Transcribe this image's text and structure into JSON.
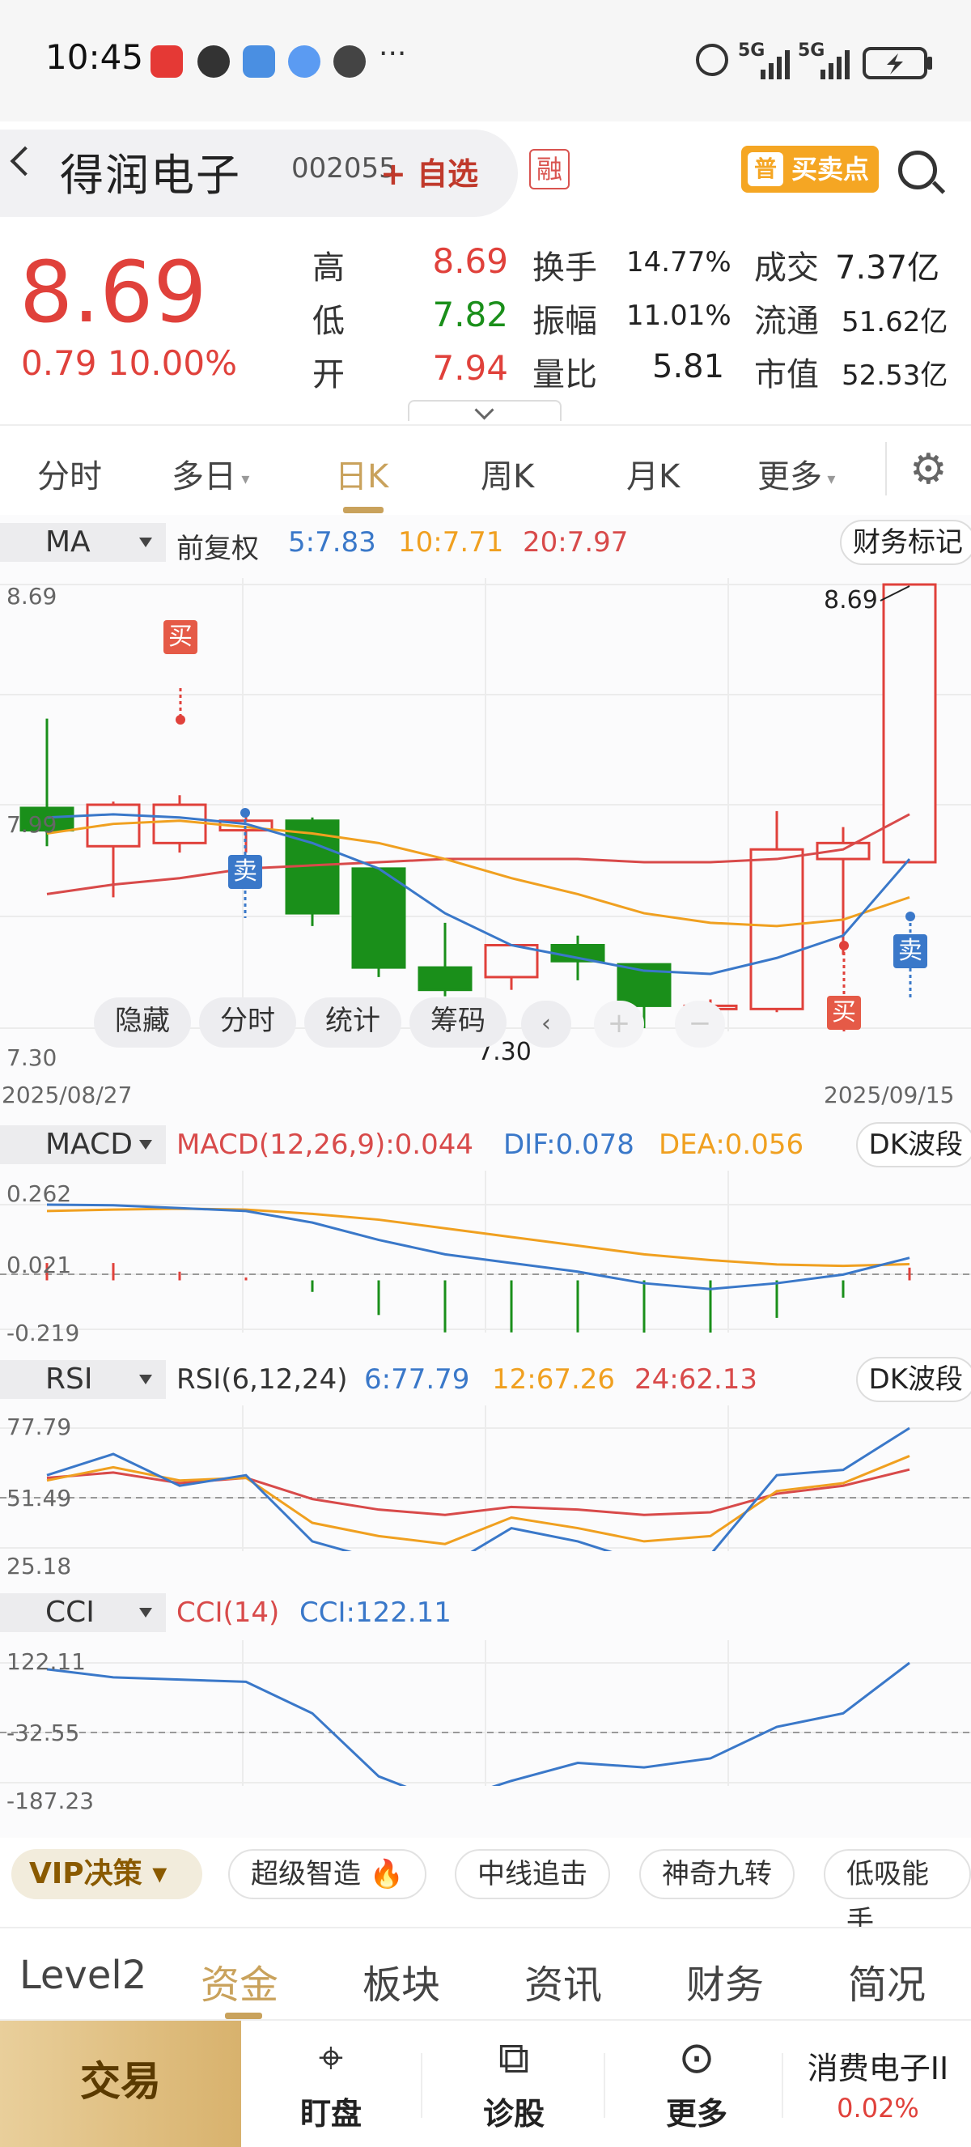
{
  "statusbar": {
    "time": "10:45",
    "more": "···",
    "net1": "5G",
    "net2": "5G"
  },
  "header": {
    "stock_name": "得润电子",
    "stock_code": "002055",
    "add_watch": "+ 自选",
    "margin_badge": "融",
    "buysell_icon": "普",
    "buysell_label": "买卖点"
  },
  "quote": {
    "price": "8.69",
    "change": "0.79 10.00%",
    "high_label": "高",
    "high": "8.69",
    "low_label": "低",
    "low": "7.82",
    "open_label": "开",
    "open": "7.94",
    "turnover_label": "换手",
    "turnover": "14.77%",
    "amplitude_label": "振幅",
    "amplitude": "11.01%",
    "volratio_label": "量比",
    "volratio": "5.81",
    "amount_label": "成交",
    "amount": "7.37亿",
    "float_label": "流通",
    "float": "51.62亿",
    "mktcap_label": "市值",
    "mktcap": "52.53亿"
  },
  "tabs": {
    "t1": "分时",
    "t2": "多日",
    "t3": "日K",
    "t4": "周K",
    "t5": "月K",
    "t6": "更多"
  },
  "ma_legend": {
    "sel": "MA",
    "adj": "前复权",
    "ma5": "5:7.83",
    "ma10": "10:7.71",
    "ma20": "20:7.97",
    "fin": "财务标记"
  },
  "kline": {
    "y_top": "8.69",
    "y_mid": "7.99",
    "y_bot": "7.30",
    "date_start": "2025/08/27",
    "date_end": "2025/09/15",
    "max_label": "8.69",
    "min_label": "7.30",
    "buy_label": "买",
    "sell_label": "卖",
    "toolbar": {
      "hide": "隐藏",
      "fenshi": "分时",
      "stats": "统计",
      "chips": "筹码"
    }
  },
  "macd": {
    "sel": "MACD",
    "main": "MACD(12,26,9):0.044",
    "dif": "DIF:0.078",
    "dea": "DEA:0.056",
    "dk": "DK波段",
    "y_top": "0.262",
    "y_mid": "0.021",
    "y_bot": "-0.219"
  },
  "rsi": {
    "sel": "RSI",
    "main": "RSI(6,12,24)",
    "r6": "6:77.79",
    "r12": "12:67.26",
    "r24": "24:62.13",
    "dk": "DK波段",
    "y_top": "77.79",
    "y_mid": "51.49",
    "y_bot": "25.18"
  },
  "cci": {
    "sel": "CCI",
    "main": "CCI(14)",
    "val": "CCI:122.11",
    "y_top": "122.11",
    "y_mid": "-32.55",
    "y_bot": "-187.23"
  },
  "vip": {
    "label": "VIP决策",
    "b1": "超级智造",
    "b2": "中线追击",
    "b3": "神奇九转",
    "b4": "低吸能手"
  },
  "bottom_tabs": {
    "t1": "Level2",
    "t2": "资金",
    "t3": "板块",
    "t4": "资讯",
    "t5": "财务",
    "t6": "简况"
  },
  "bottom_bar": {
    "trade": "交易",
    "watch": "盯盘",
    "diag": "诊股",
    "more": "更多",
    "sector": "消费电子II",
    "sector_pct": "0.02%"
  },
  "colors": {
    "up": "#e0413b",
    "down": "#1a8f1a",
    "ma5": "#3a78c9",
    "ma10": "#f0a020",
    "ma20": "#d84a4a",
    "accent": "#c9a25c"
  },
  "chart_data": {
    "type": "candlestick",
    "price_range": [
      7.3,
      8.69
    ],
    "candles": [
      {
        "o": 7.99,
        "h": 8.27,
        "l": 7.87,
        "c": 7.92
      },
      {
        "o": 7.87,
        "h": 8.01,
        "l": 7.71,
        "c": 8.0
      },
      {
        "o": 7.88,
        "h": 8.03,
        "l": 7.85,
        "c": 8.0
      },
      {
        "o": 7.92,
        "h": 7.98,
        "l": 7.85,
        "c": 7.95
      },
      {
        "o": 7.95,
        "h": 7.96,
        "l": 7.62,
        "c": 7.66
      },
      {
        "o": 7.8,
        "h": 7.8,
        "l": 7.46,
        "c": 7.49
      },
      {
        "o": 7.49,
        "h": 7.63,
        "l": 7.4,
        "c": 7.42
      },
      {
        "o": 7.46,
        "h": 7.56,
        "l": 7.42,
        "c": 7.56
      },
      {
        "o": 7.56,
        "h": 7.59,
        "l": 7.45,
        "c": 7.51
      },
      {
        "o": 7.5,
        "h": 7.5,
        "l": 7.3,
        "c": 7.37
      },
      {
        "o": 7.36,
        "h": 7.39,
        "l": 7.34,
        "c": 7.37
      },
      {
        "o": 7.36,
        "h": 7.98,
        "l": 7.35,
        "c": 7.86
      },
      {
        "o": 7.83,
        "h": 7.93,
        "l": 7.53,
        "c": 7.88
      },
      {
        "o": 7.82,
        "h": 8.69,
        "l": 7.82,
        "c": 8.69
      }
    ],
    "ma5": [
      7.96,
      7.97,
      7.96,
      7.94,
      7.88,
      7.8,
      7.66,
      7.56,
      7.52,
      7.48,
      7.47,
      7.52,
      7.59,
      7.83
    ],
    "ma10": [
      7.91,
      7.94,
      7.95,
      7.93,
      7.91,
      7.88,
      7.83,
      7.77,
      7.72,
      7.66,
      7.63,
      7.62,
      7.64,
      7.71
    ],
    "ma20": [
      7.72,
      7.75,
      7.77,
      7.8,
      7.81,
      7.82,
      7.83,
      7.83,
      7.83,
      7.82,
      7.82,
      7.83,
      7.86,
      7.97
    ],
    "macd": {
      "dif": [
        0.262,
        0.26,
        0.25,
        0.24,
        0.2,
        0.14,
        0.09,
        0.06,
        0.03,
        -0.01,
        -0.03,
        -0.01,
        0.02,
        0.078
      ],
      "dea": [
        0.24,
        0.245,
        0.248,
        0.245,
        0.23,
        0.21,
        0.18,
        0.15,
        0.12,
        0.09,
        0.07,
        0.055,
        0.05,
        0.056
      ],
      "hist": [
        0.06,
        0.06,
        0.03,
        0.01,
        -0.04,
        -0.12,
        -0.18,
        -0.18,
        -0.18,
        -0.2,
        -0.2,
        -0.13,
        -0.06,
        0.044
      ]
    },
    "rsi": {
      "r6": [
        60,
        68,
        56,
        60,
        35,
        28,
        25,
        40,
        35,
        27,
        30,
        60,
        62,
        77.79
      ],
      "r12": [
        58,
        63,
        58,
        59,
        42,
        37,
        34,
        44,
        40,
        35,
        37,
        54,
        57,
        67.26
      ],
      "r24": [
        59,
        61,
        57,
        59,
        51,
        47,
        45,
        48,
        47,
        45,
        46,
        53,
        56,
        62.13
      ]
    },
    "cci": [
      108,
      90,
      85,
      80,
      10,
      -130,
      -187,
      -140,
      -100,
      -110,
      -90,
      -20,
      10,
      122.11
    ]
  }
}
